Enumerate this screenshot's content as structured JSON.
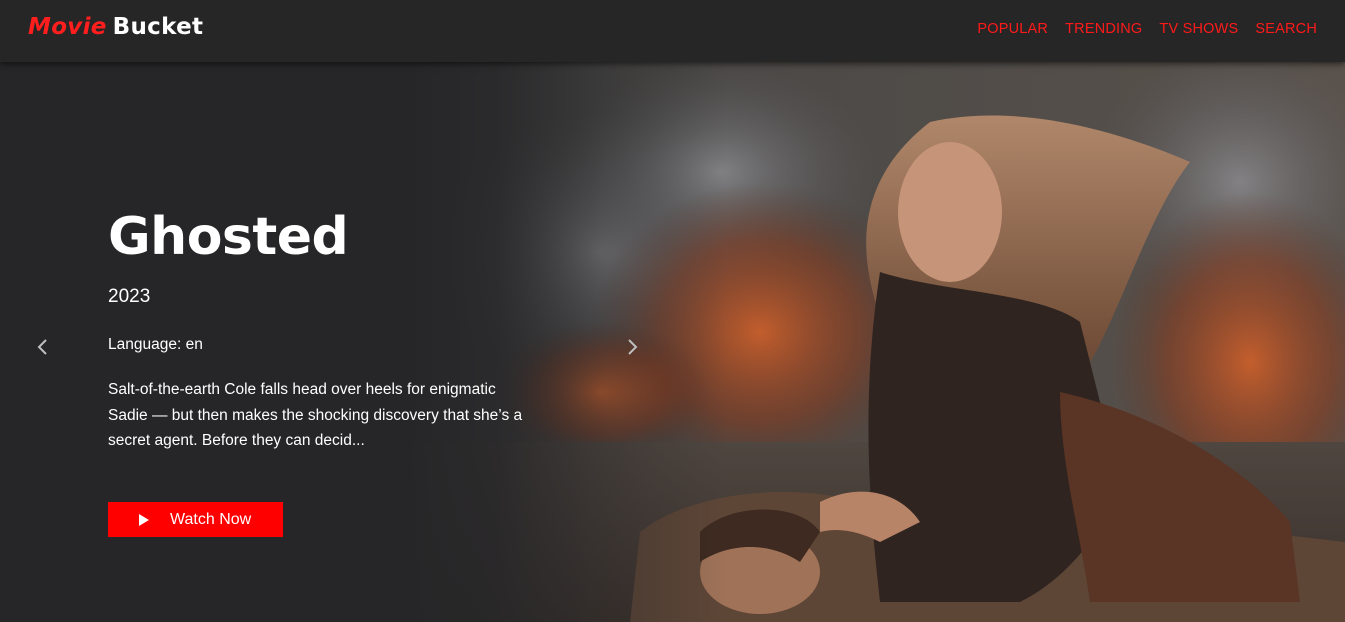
{
  "brand": {
    "part1": "Movie",
    "part2": "Bucket"
  },
  "nav": {
    "items": [
      {
        "label": "POPULAR"
      },
      {
        "label": "TRENDING"
      },
      {
        "label": "TV SHOWS"
      },
      {
        "label": "SEARCH"
      }
    ]
  },
  "hero": {
    "title": "Ghosted",
    "year": "2023",
    "language": "Language: en",
    "overview": "Salt-of-the-earth Cole falls head over heels for enigmatic Sadie — but then makes the shocking discovery that she’s a secret agent. Before they can decid...",
    "watch_label": "Watch Now"
  },
  "icons": {
    "prev": "chevron-left-icon",
    "next": "chevron-right-icon",
    "play": "play-icon"
  },
  "colors": {
    "accent": "#ff0000",
    "nav_text": "#ff1a1a",
    "navbar_bg": "#262626",
    "page_bg": "#262628"
  }
}
